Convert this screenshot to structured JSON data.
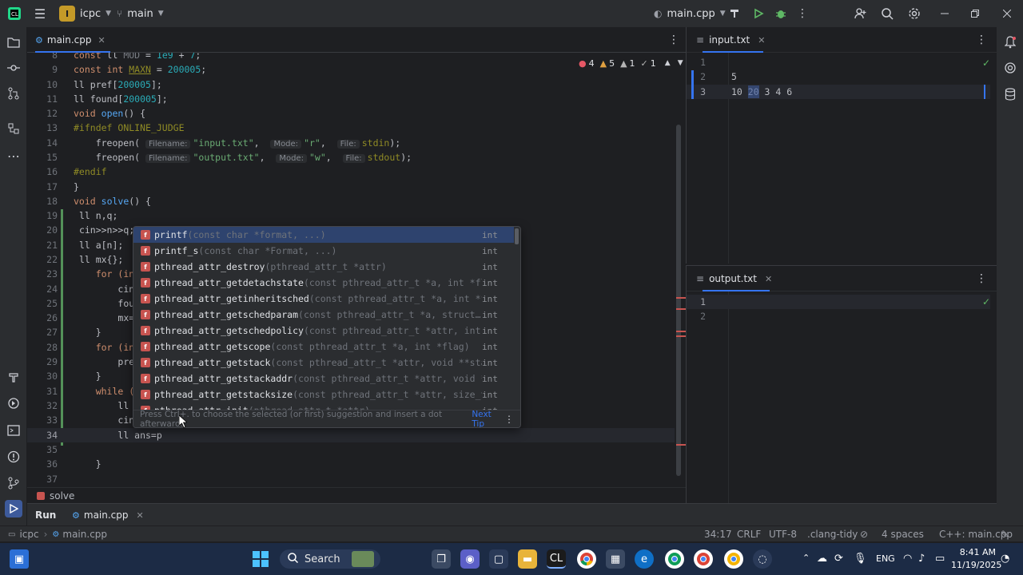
{
  "titlebar": {
    "project_initial": "I",
    "project_name": "icpc",
    "branch": "main",
    "run_config": "main.cpp"
  },
  "editor": {
    "tab_label": "main.cpp",
    "problems": {
      "errors": "4",
      "warnings": "5",
      "weak": "1",
      "info": "1"
    },
    "lines": [
      {
        "n": "8",
        "c": "const ll MOD = 1e9 + 7;"
      },
      {
        "n": "9",
        "c": "const int MAXN = 200005;"
      },
      {
        "n": "10",
        "c": "ll pref[200005];"
      },
      {
        "n": "11",
        "c": "ll found[200005];"
      },
      {
        "n": "12",
        "c": "void open() {"
      },
      {
        "n": "13",
        "c": "#ifndef ONLINE_JUDGE"
      },
      {
        "n": "14",
        "c": "freopen( Filename: \"input.txt\",  Mode: \"r\",  File: stdin);"
      },
      {
        "n": "15",
        "c": "freopen( Filename: \"output.txt\",  Mode: \"w\",  File: stdout);"
      },
      {
        "n": "16",
        "c": "#endif"
      },
      {
        "n": "17",
        "c": "}"
      },
      {
        "n": "18",
        "c": "void solve() {"
      },
      {
        "n": "19",
        "c": "ll n,q;"
      },
      {
        "n": "20",
        "c": "cin>>n>>q;"
      },
      {
        "n": "21",
        "c": "ll a[n];"
      },
      {
        "n": "22",
        "c": "ll mx{};"
      },
      {
        "n": "23",
        "c": "for (in"
      },
      {
        "n": "24",
        "c": "cin"
      },
      {
        "n": "25",
        "c": "fou"
      },
      {
        "n": "26",
        "c": "mx="
      },
      {
        "n": "27",
        "c": "}"
      },
      {
        "n": "28",
        "c": "for (in"
      },
      {
        "n": "29",
        "c": "pre"
      },
      {
        "n": "30",
        "c": "}"
      },
      {
        "n": "31",
        "c": "while ("
      },
      {
        "n": "32",
        "c": "ll"
      },
      {
        "n": "33",
        "c": "cin"
      },
      {
        "n": "34",
        "c": "ll ans=p"
      },
      {
        "n": "35",
        "c": ""
      },
      {
        "n": "36",
        "c": "}"
      },
      {
        "n": "37",
        "c": ""
      }
    ],
    "hints": {
      "filename": "Filename:",
      "mode": "Mode:",
      "file": "File:"
    },
    "breadcrumb": "solve"
  },
  "completion": {
    "items": [
      {
        "name": "printf",
        "sig": "(const char *format, ...)",
        "type": "int"
      },
      {
        "name": "printf_s",
        "sig": "(const char *Format, ...)",
        "type": "int"
      },
      {
        "name": "pthread_attr_destroy",
        "sig": "(pthread_attr_t *attr)",
        "type": "int"
      },
      {
        "name": "pthread_attr_getdetachstate",
        "sig": "(const pthread_attr_t *a, int *fla…",
        "type": "int"
      },
      {
        "name": "pthread_attr_getinheritsched",
        "sig": "(const pthread_attr_t *a, int *fl…",
        "type": "int"
      },
      {
        "name": "pthread_attr_getschedparam",
        "sig": "(const pthread_attr_t *a, struct…",
        "type": "int"
      },
      {
        "name": "pthread_attr_getschedpolicy",
        "sig": "(const pthread_attr_t *attr, int *…",
        "type": "int"
      },
      {
        "name": "pthread_attr_getscope",
        "sig": "(const pthread_attr_t *a, int *flag)",
        "type": "int"
      },
      {
        "name": "pthread_attr_getstack",
        "sig": "(const pthread_attr_t *attr, void **stac…",
        "type": "int"
      },
      {
        "name": "pthread_attr_getstackaddr",
        "sig": "(const pthread_attr_t *attr, void **…",
        "type": "int"
      },
      {
        "name": "pthread_attr_getstacksize",
        "sig": "(const pthread_attr_t *attr, size_t …",
        "type": "int"
      },
      {
        "name": "pthread_attr_init",
        "sig": "(pthread_attr_t *attr)",
        "type": "int"
      }
    ],
    "footer": "Press Ctrl+. to choose the selected (or first) suggestion and insert a dot afterwards",
    "next_tip": "Next Tip"
  },
  "input_panel": {
    "tab_label": "input.txt",
    "lines": [
      {
        "n": "1",
        "c": ""
      },
      {
        "n": "2",
        "c": "5"
      },
      {
        "n": "3",
        "c": "10 20 3 4 6"
      }
    ]
  },
  "output_panel": {
    "tab_label": "output.txt",
    "lines": [
      {
        "n": "1",
        "c": ""
      },
      {
        "n": "2",
        "c": ""
      }
    ]
  },
  "runbar": {
    "run_label": "Run",
    "tab_label": "main.cpp"
  },
  "statusbar": {
    "project": "icpc",
    "file": "main.cpp",
    "position": "34:17",
    "line_ending": "CRLF",
    "encoding": "UTF-8",
    "linter": ".clang-tidy",
    "indent": "4 spaces",
    "context": "C++: main.cpp"
  },
  "taskbar": {
    "search": "Search",
    "lang": "ENG",
    "time": "8:41 AM",
    "date": "11/19/2025"
  },
  "colors": {
    "accent": "#3574f0",
    "bg": "#1e1f22",
    "panel": "#2b2d30",
    "selection": "#2e436e"
  }
}
